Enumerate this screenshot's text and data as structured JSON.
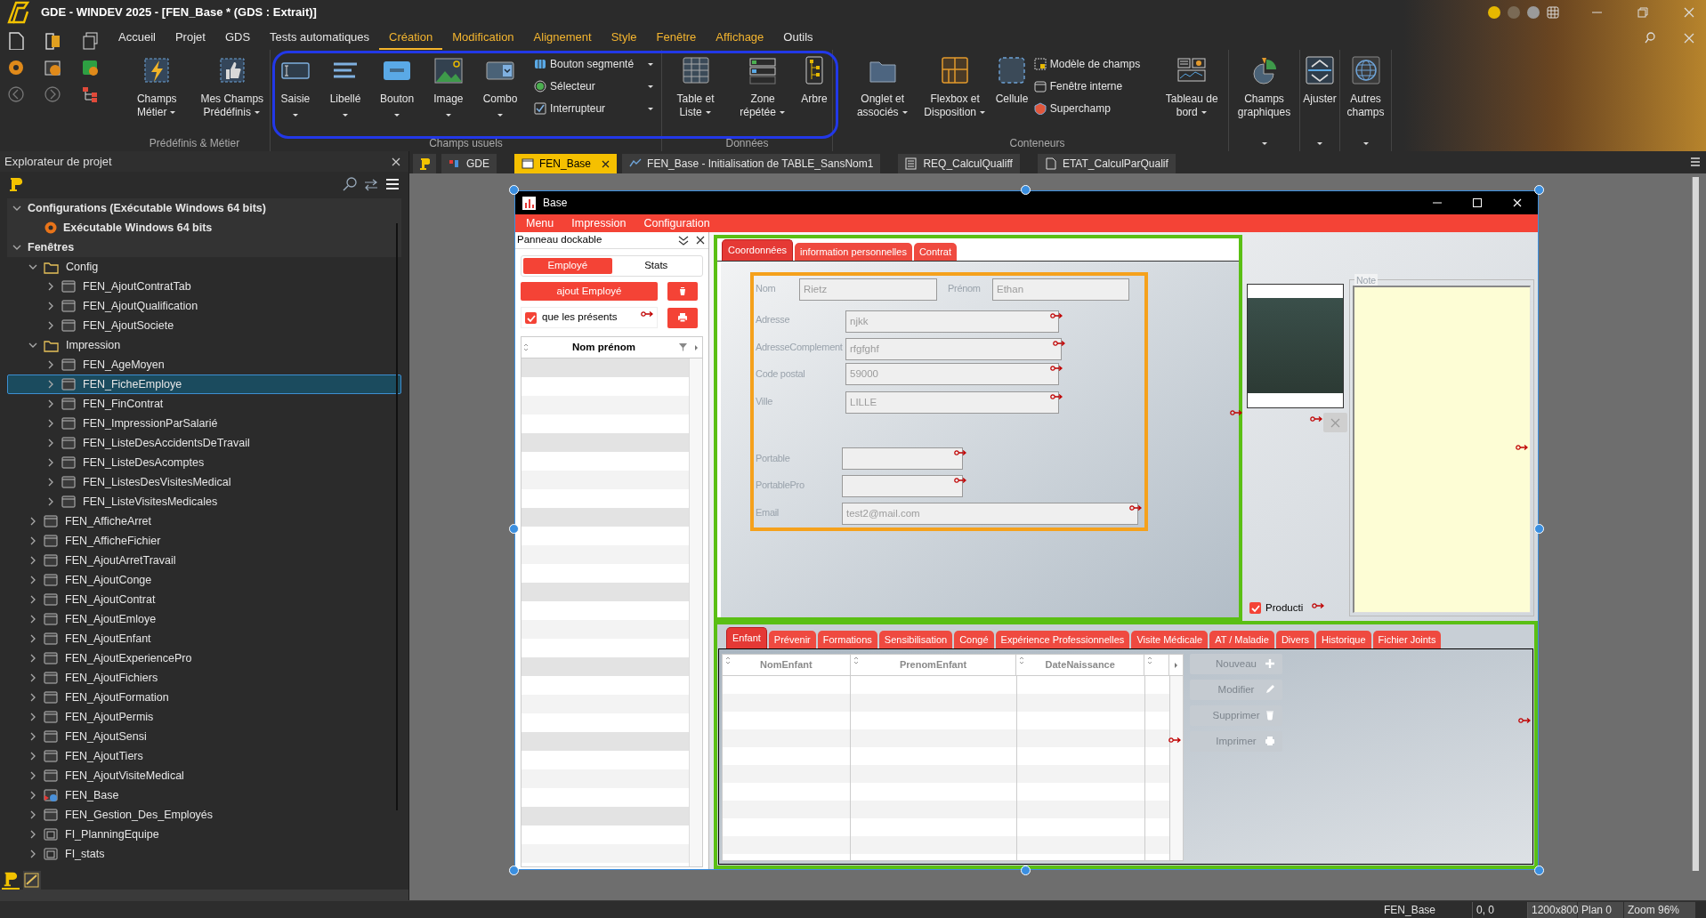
{
  "app_title": "GDE - WINDEV 2025 - [FEN_Base * (GDS : Extrait)]",
  "ribbon_tabs": [
    {
      "label": "Accueil",
      "kind": "main",
      "selected": false
    },
    {
      "label": "Projet",
      "kind": "main",
      "selected": false
    },
    {
      "label": "GDS",
      "kind": "main",
      "selected": false
    },
    {
      "label": "Tests automatiques",
      "kind": "main",
      "selected": false
    },
    {
      "label": "Création",
      "kind": "context",
      "selected": true
    },
    {
      "label": "Modification",
      "kind": "context",
      "selected": false
    },
    {
      "label": "Alignement",
      "kind": "context",
      "selected": false
    },
    {
      "label": "Style",
      "kind": "context",
      "selected": false
    },
    {
      "label": "Fenêtre",
      "kind": "context",
      "selected": false
    },
    {
      "label": "Affichage",
      "kind": "context",
      "selected": false
    },
    {
      "label": "Outils",
      "kind": "main",
      "selected": false
    }
  ],
  "ribbon_groups": [
    {
      "label": "Prédéfinis & Métier",
      "items": [
        {
          "kind": "large",
          "label": "Champs Métier",
          "dropdown": true
        },
        {
          "kind": "large",
          "label": "Mes Champs Prédéfinis",
          "dropdown": true
        }
      ]
    },
    {
      "label": "Champs usuels",
      "items": [
        {
          "kind": "large",
          "label": "Saisie",
          "dropdown": true
        },
        {
          "kind": "large",
          "label": "Libellé",
          "dropdown": true
        },
        {
          "kind": "large",
          "label": "Bouton",
          "dropdown": true
        },
        {
          "kind": "large",
          "label": "Image",
          "dropdown": true
        },
        {
          "kind": "large",
          "label": "Combo",
          "dropdown": true
        },
        {
          "kind": "small",
          "label": "Bouton segmenté",
          "dropdown": true
        },
        {
          "kind": "small",
          "label": "Sélecteur",
          "dropdown": true
        },
        {
          "kind": "small",
          "label": "Interrupteur",
          "dropdown": true
        }
      ]
    },
    {
      "label": "Données",
      "items": [
        {
          "kind": "large",
          "label": "Table et Liste",
          "dropdown": true
        },
        {
          "kind": "large",
          "label": "Zone répétée",
          "dropdown": true
        },
        {
          "kind": "large",
          "label": "Arbre",
          "dropdown": false
        }
      ]
    },
    {
      "label": "Conteneurs",
      "items": [
        {
          "kind": "large",
          "label": "Onglet et associés",
          "dropdown": true
        },
        {
          "kind": "large",
          "label": "Flexbox et Disposition",
          "dropdown": true
        },
        {
          "kind": "large",
          "label": "Cellule",
          "dropdown": false
        },
        {
          "kind": "small",
          "label": "Modèle de champs",
          "dropdown": false
        },
        {
          "kind": "small",
          "label": "Fenêtre interne",
          "dropdown": false
        },
        {
          "kind": "small",
          "label": "Superchamp",
          "dropdown": false
        },
        {
          "kind": "large",
          "label": "Tableau de bord",
          "dropdown": true
        }
      ]
    },
    {
      "items": [
        {
          "kind": "large",
          "label": "Champs graphiques",
          "dropdown": true
        }
      ]
    },
    {
      "items": [
        {
          "kind": "large",
          "label": "Ajuster",
          "dropdown": true
        }
      ]
    },
    {
      "items": [
        {
          "kind": "large",
          "label": "Autres champs",
          "dropdown": true
        }
      ]
    }
  ],
  "doc_tabs": [
    {
      "label": "GDE",
      "kind": "project",
      "selected": false
    },
    {
      "label": "FEN_Base",
      "kind": "window",
      "selected": true
    },
    {
      "label": "FEN_Base - Initialisation de TABLE_SansNom1",
      "kind": "code",
      "selected": false
    },
    {
      "label": "REQ_CalculQualiff",
      "kind": "query",
      "selected": false
    },
    {
      "label": "ETAT_CalculParQualif",
      "kind": "report",
      "selected": false
    }
  ],
  "explorer": {
    "title": "Explorateur de projet",
    "tree": [
      {
        "label": "Configurations (Exécutable Windows 64 bits)",
        "kind": "section",
        "expanded": true,
        "selected": false,
        "children": [
          {
            "label": "Exécutable Windows 64 bits",
            "kind": "config",
            "selected": false
          }
        ]
      },
      {
        "label": "Fenêtres",
        "kind": "section",
        "expanded": true,
        "selected": false,
        "children": [
          {
            "label": "Config",
            "kind": "folder",
            "expanded": true,
            "selected": false,
            "children": [
              {
                "label": "FEN_AjoutContratTab",
                "kind": "window",
                "expanded": false,
                "selected": false
              },
              {
                "label": "FEN_AjoutQualification",
                "kind": "window",
                "expanded": false,
                "selected": false
              },
              {
                "label": "FEN_AjoutSociete",
                "kind": "window",
                "expanded": false,
                "selected": false
              }
            ]
          },
          {
            "label": "Impression",
            "kind": "folder",
            "expanded": true,
            "selected": false,
            "children": [
              {
                "label": "FEN_AgeMoyen",
                "kind": "window",
                "expanded": false,
                "selected": false
              },
              {
                "label": "FEN_FicheEmploye",
                "kind": "window",
                "expanded": false,
                "selected": true
              },
              {
                "label": "FEN_FinContrat",
                "kind": "window",
                "expanded": false,
                "selected": false
              },
              {
                "label": "FEN_ImpressionParSalarié",
                "kind": "window",
                "expanded": false,
                "selected": false
              },
              {
                "label": "FEN_ListeDesAccidentsDeTravail",
                "kind": "window",
                "expanded": false,
                "selected": false
              },
              {
                "label": "FEN_ListeDesAcomptes",
                "kind": "window",
                "expanded": false,
                "selected": false
              },
              {
                "label": "FEN_ListesDesVisitesMedical",
                "kind": "window",
                "expanded": false,
                "selected": false
              },
              {
                "label": "FEN_ListeVisitesMedicales",
                "kind": "window",
                "expanded": false,
                "selected": false
              }
            ]
          },
          {
            "label": "FEN_AfficheArret",
            "kind": "window",
            "expanded": false,
            "selected": false
          },
          {
            "label": "FEN_AfficheFichier",
            "kind": "window",
            "expanded": false,
            "selected": false
          },
          {
            "label": "FEN_AjoutArretTravail",
            "kind": "window",
            "expanded": false,
            "selected": false
          },
          {
            "label": "FEN_AjoutConge",
            "kind": "window",
            "expanded": false,
            "selected": false
          },
          {
            "label": "FEN_AjoutContrat",
            "kind": "window",
            "expanded": false,
            "selected": false
          },
          {
            "label": "FEN_AjoutEmloye",
            "kind": "window",
            "expanded": false,
            "selected": false
          },
          {
            "label": "FEN_AjoutEnfant",
            "kind": "window",
            "expanded": false,
            "selected": false
          },
          {
            "label": "FEN_AjoutExperiencePro",
            "kind": "window",
            "expanded": false,
            "selected": false
          },
          {
            "label": "FEN_AjoutFichiers",
            "kind": "window",
            "expanded": false,
            "selected": false
          },
          {
            "label": "FEN_AjoutFormation",
            "kind": "window",
            "expanded": false,
            "selected": false
          },
          {
            "label": "FEN_AjoutPermis",
            "kind": "window",
            "expanded": false,
            "selected": false
          },
          {
            "label": "FEN_AjoutSensi",
            "kind": "window",
            "expanded": false,
            "selected": false
          },
          {
            "label": "FEN_AjoutTiers",
            "kind": "window",
            "expanded": false,
            "selected": false
          },
          {
            "label": "FEN_AjoutVisiteMedical",
            "kind": "window",
            "expanded": false,
            "selected": false
          },
          {
            "label": "FEN_Base",
            "kind": "main-window",
            "expanded": false,
            "selected": false
          },
          {
            "label": "FEN_Gestion_Des_Employés",
            "kind": "window",
            "expanded": false,
            "selected": false
          },
          {
            "label": "FI_PlanningEquipe",
            "kind": "internal",
            "expanded": false,
            "selected": false
          },
          {
            "label": "FI_stats",
            "kind": "internal",
            "expanded": false,
            "selected": false
          }
        ]
      }
    ]
  },
  "form": {
    "title": "Base",
    "menu": [
      "Menu",
      "Impression",
      "Configuration"
    ],
    "dock": {
      "title": "Panneau dockable",
      "segments": [
        {
          "label": "Employé",
          "selected": true
        },
        {
          "label": "Stats",
          "selected": false
        }
      ],
      "add_button": "ajout Employé",
      "filter": {
        "label": "que les présents",
        "checked": true
      },
      "table_column": "Nom prénom"
    },
    "top_tabs": [
      {
        "label": "Coordonnées",
        "selected": true
      },
      {
        "label": "information personnelles",
        "selected": false
      },
      {
        "label": "Contrat",
        "selected": false
      }
    ],
    "fields": [
      {
        "label": "Nom",
        "value": "Rietz"
      },
      {
        "label": "Prénom",
        "value": "Ethan"
      },
      {
        "label": "Adresse",
        "value": "njkk"
      },
      {
        "label": "AdresseComplement",
        "value": "rfgfghf"
      },
      {
        "label": "Code postal",
        "value": "59000"
      },
      {
        "label": "Ville",
        "value": "LILLE"
      },
      {
        "label": "Portable"
      },
      {
        "label": "PortablePro"
      },
      {
        "label": "Email",
        "value": "test2@mail.com"
      }
    ],
    "productive": {
      "label": "Producti",
      "checked": true
    },
    "note": {
      "label": "Note"
    },
    "bottom_tabs": [
      {
        "label": "Enfant",
        "selected": true
      },
      {
        "label": "Prévenir",
        "selected": false
      },
      {
        "label": "Formations",
        "selected": false
      },
      {
        "label": "Sensibilisation",
        "selected": false
      },
      {
        "label": "Congé",
        "selected": false
      },
      {
        "label": "Expérience Professionnelles",
        "selected": false
      },
      {
        "label": "Visite Médicale",
        "selected": false
      },
      {
        "label": "AT / Maladie",
        "selected": false
      },
      {
        "label": "Divers",
        "selected": false
      },
      {
        "label": "Historique",
        "selected": false
      },
      {
        "label": "Fichier Joints",
        "selected": false
      }
    ],
    "child_table": {
      "columns": [
        "NomEnfant",
        "PrenomEnfant",
        "DateNaissance"
      ]
    },
    "actions": [
      {
        "label": "Nouveau",
        "disabled": true
      },
      {
        "label": "Modifier",
        "disabled": true
      },
      {
        "label": "Supprimer",
        "disabled": true
      },
      {
        "label": "Imprimer",
        "disabled": true
      }
    ]
  },
  "status_bar": [
    "FEN_Base",
    "0, 0",
    "1200x800",
    "Plan 0",
    "Zoom 96%"
  ]
}
